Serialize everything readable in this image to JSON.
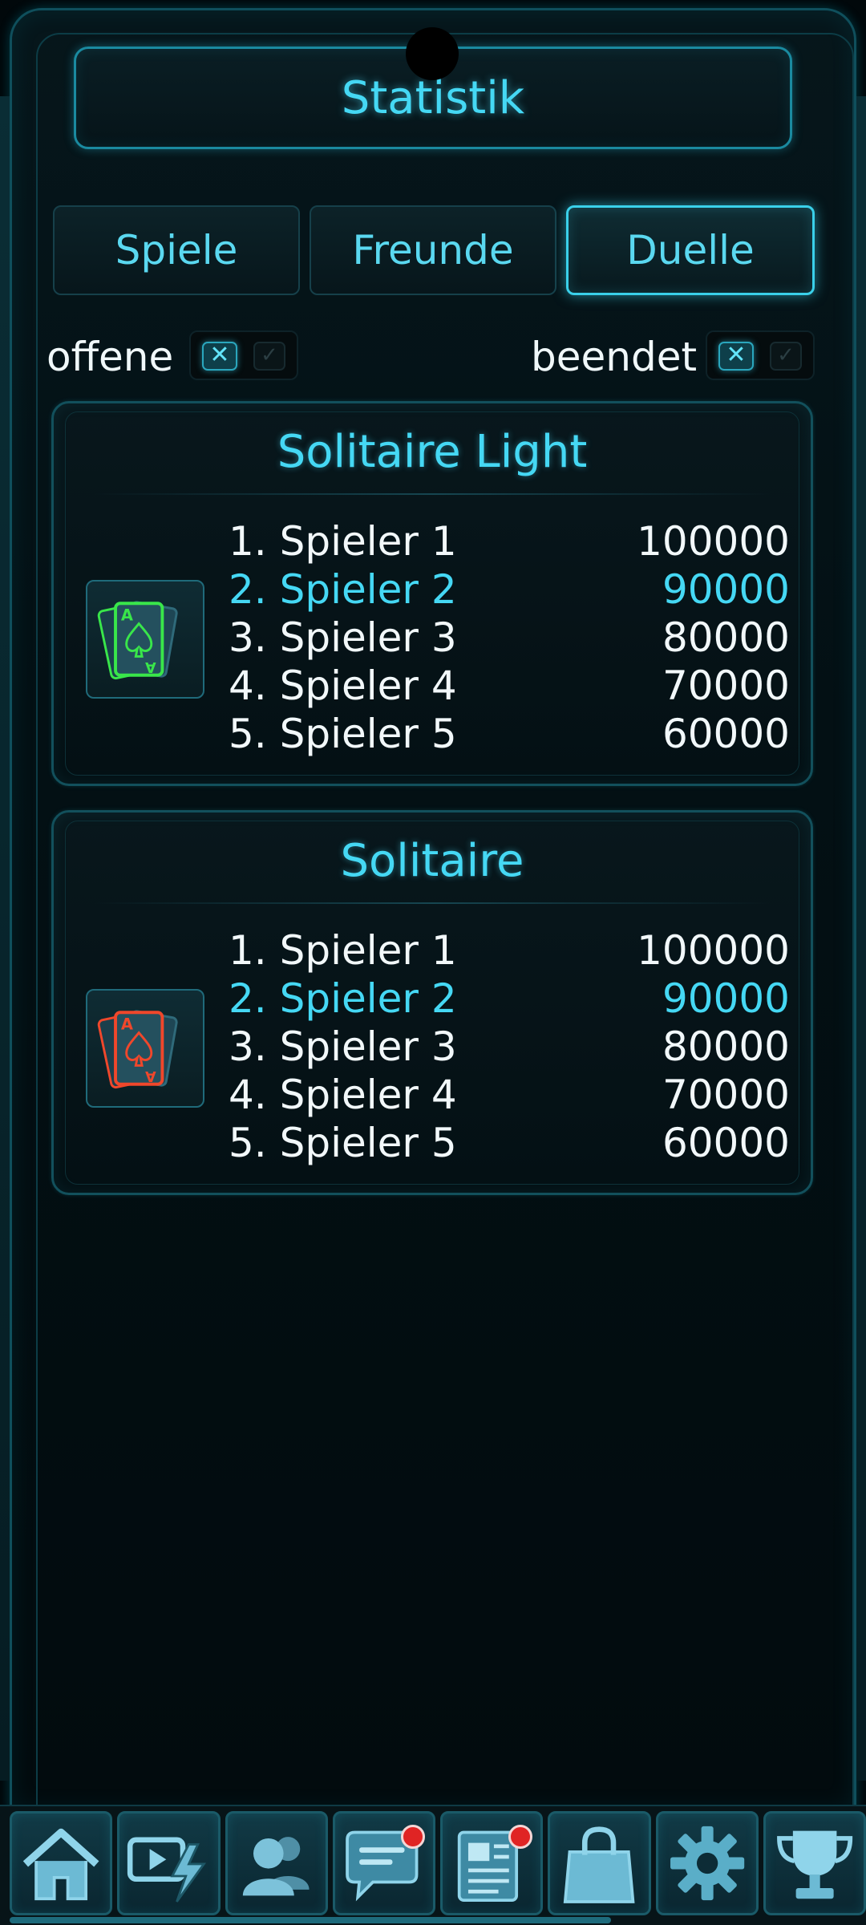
{
  "header": {
    "title": "Statistik"
  },
  "tabs": [
    {
      "label": "Spiele",
      "active": false
    },
    {
      "label": "Freunde",
      "active": false
    },
    {
      "label": "Duelle",
      "active": true
    }
  ],
  "filters": {
    "open": {
      "label": "offene",
      "enabled": true
    },
    "finished": {
      "label": "beendet",
      "enabled": true
    }
  },
  "cards": [
    {
      "title": "Solitaire Light",
      "icon": "green-spade-cards-icon",
      "accent_color": "#39e64a",
      "rows": [
        {
          "rank": "1. Spieler 1",
          "score": "100000",
          "highlight": false
        },
        {
          "rank": "2. Spieler 2",
          "score": "90000",
          "highlight": true
        },
        {
          "rank": "3. Spieler 3",
          "score": "80000",
          "highlight": false
        },
        {
          "rank": "4. Spieler 4",
          "score": "70000",
          "highlight": false
        },
        {
          "rank": "5. Spieler 5",
          "score": "60000",
          "highlight": false
        }
      ]
    },
    {
      "title": "Solitaire",
      "icon": "red-spade-cards-icon",
      "accent_color": "#f0472b",
      "rows": [
        {
          "rank": "1. Spieler 1",
          "score": "100000",
          "highlight": false
        },
        {
          "rank": "2. Spieler 2",
          "score": "90000",
          "highlight": true
        },
        {
          "rank": "3. Spieler 3",
          "score": "80000",
          "highlight": false
        },
        {
          "rank": "4. Spieler 4",
          "score": "70000",
          "highlight": false
        },
        {
          "rank": "5. Spieler 5",
          "score": "60000",
          "highlight": false
        }
      ]
    }
  ],
  "bottom_nav": [
    {
      "icon": "home-icon",
      "badge": false
    },
    {
      "icon": "video-lightning-icon",
      "badge": false
    },
    {
      "icon": "friends-icon",
      "badge": false
    },
    {
      "icon": "chat-icon",
      "badge": true
    },
    {
      "icon": "news-icon",
      "badge": true
    },
    {
      "icon": "shop-bag-icon",
      "badge": false
    },
    {
      "icon": "settings-gear-icon",
      "badge": false
    },
    {
      "icon": "trophy-icon",
      "badge": false
    }
  ],
  "colors": {
    "accent": "#45d8f4",
    "badge": "#e02424",
    "background": "#01080b"
  }
}
